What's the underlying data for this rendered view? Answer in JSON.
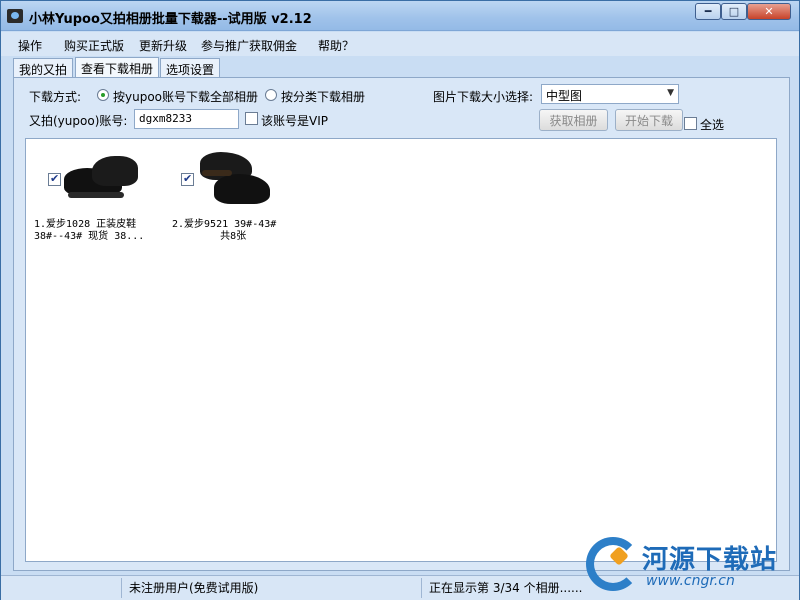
{
  "window": {
    "title": "小林Yupoo又拍相册批量下载器--试用版 v2.12",
    "minimize_label": "━",
    "maximize_label": "□",
    "close_label": "✕"
  },
  "menu": [
    "操作",
    "购买正式版",
    "更新升级",
    "参与推广获取佣金",
    "帮助？"
  ],
  "tabs": [
    "我的又拍",
    "查看下载相册",
    "选项设置"
  ],
  "form": {
    "download_mode_label": "下载方式:",
    "mode_all_label": "按yupoo账号下载全部相册",
    "mode_category_label": "按分类下载相册",
    "image_size_label": "图片下载大小选择:",
    "image_size_value": "中型图",
    "account_label": "又拍(yupoo)账号:",
    "account_value": "dgxm8233",
    "vip_label": "该账号是VIP",
    "fetch_button": "获取相册",
    "start_button": "开始下载",
    "select_all_label": "全选"
  },
  "albums": [
    {
      "caption": "1.爱步1028 正装皮鞋\n38#--43# 现货 38...",
      "checked": true
    },
    {
      "caption": "2.爱步9521 39#-43#\n        共8张",
      "checked": true
    }
  ],
  "status": {
    "user": "未注册用户(免费试用版)",
    "progress": "正在显示第 3/34 个相册......"
  },
  "watermark": {
    "name": "河源下载站",
    "url": "www.cngr.cn"
  }
}
